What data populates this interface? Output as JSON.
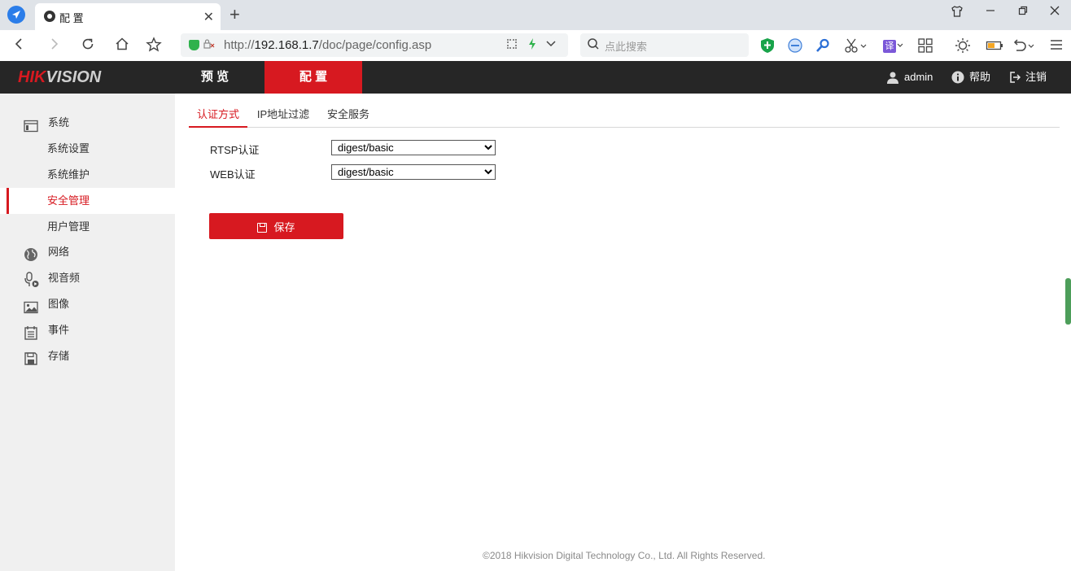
{
  "browser": {
    "tab_title": "配 置",
    "tab_close": "✕",
    "new_tab": "+",
    "url_prefix": "http://",
    "url_host": "192.168.1.7",
    "url_path": "/doc/page/config.asp",
    "search_placeholder": "点此搜索",
    "translate_label": "译"
  },
  "header": {
    "logo_red": "HIK",
    "logo_gray": "VISION",
    "nav": [
      {
        "label": "预 览"
      },
      {
        "label": "配 置"
      }
    ],
    "user": "admin",
    "help": "帮助",
    "logout": "注销"
  },
  "sidebar": {
    "items": [
      {
        "label": "系统",
        "icon": "window-icon"
      },
      {
        "label": "系统设置"
      },
      {
        "label": "系统维护"
      },
      {
        "label": "安全管理"
      },
      {
        "label": "用户管理"
      },
      {
        "label": "网络",
        "icon": "globe-icon"
      },
      {
        "label": "视音频",
        "icon": "microphone-icon"
      },
      {
        "label": "图像",
        "icon": "image-icon"
      },
      {
        "label": "事件",
        "icon": "calendar-icon"
      },
      {
        "label": "存储",
        "icon": "floppy-icon"
      }
    ]
  },
  "subtabs": [
    {
      "label": "认证方式"
    },
    {
      "label": "IP地址过滤"
    },
    {
      "label": "安全服务"
    }
  ],
  "form": {
    "rtsp_label": "RTSP认证",
    "rtsp_value": "digest/basic",
    "web_label": "WEB认证",
    "web_value": "digest/basic"
  },
  "save_label": "保存",
  "footer": "©2018 Hikvision Digital Technology Co., Ltd. All Rights Reserved.",
  "colors": {
    "accent": "#d71920",
    "header_bg": "#262626",
    "sidebar_bg": "#f0f0f0"
  }
}
